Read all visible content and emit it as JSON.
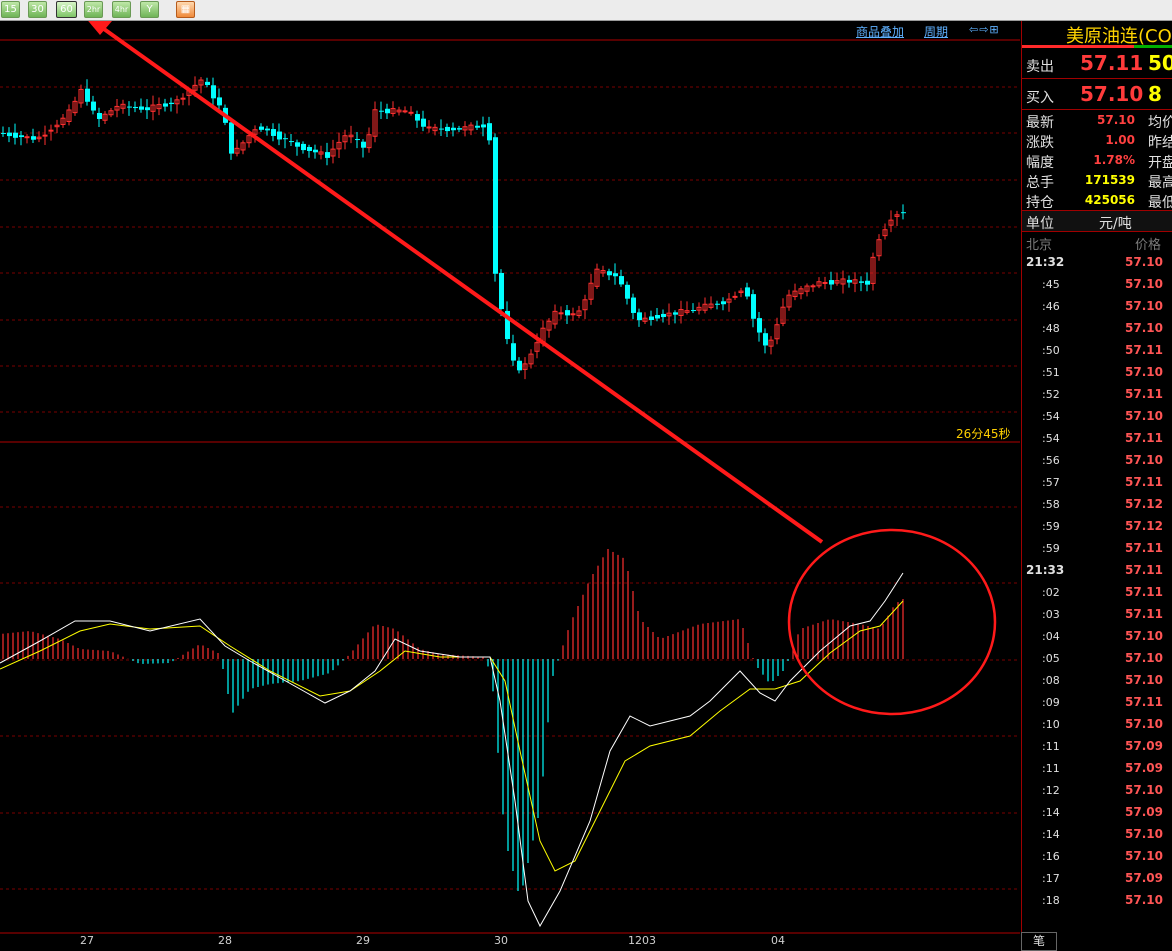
{
  "toolbar": {
    "buttons": [
      {
        "label": "15",
        "active": false
      },
      {
        "label": "30",
        "active": false
      },
      {
        "label": "60",
        "active": true
      },
      {
        "label": "2hr",
        "active": false
      },
      {
        "label": "4hr",
        "active": false
      },
      {
        "label": "Y",
        "active": false
      }
    ],
    "draw_icon": "grid-icon"
  },
  "chart_header": {
    "overlay_link": "商品叠加",
    "period_link": "周期",
    "nav_arrows": "⇦⇨⊞"
  },
  "countdown": "26分45秒",
  "x_axis_labels": [
    "27",
    "28",
    "29",
    "30",
    "1203",
    "04"
  ],
  "colors": {
    "up": "#ff3030",
    "down": "#00ffff",
    "dif_line": "#ffffff",
    "dea_line": "#ffff00",
    "grid": "#7a0000",
    "annotation": "#ff1a1a"
  },
  "chart_data": {
    "type": "candlestick",
    "series": [
      {
        "name": "price",
        "kind": "candlestick"
      },
      {
        "name": "MACD",
        "kind": "histogram"
      },
      {
        "name": "DIF",
        "kind": "line"
      },
      {
        "name": "DEA",
        "kind": "line"
      }
    ],
    "annotations": [
      "arrow from lower-right to 60 button",
      "ellipse around recent MACD golden cross"
    ]
  },
  "panel": {
    "title": "美原油连(CO",
    "sell": {
      "label": "卖出",
      "price": "57.11",
      "volume": "50"
    },
    "buy": {
      "label": "买入",
      "price": "57.10",
      "volume": "8"
    },
    "stats": [
      {
        "label": "最新",
        "value": "57.10",
        "color": "#ff4040",
        "label2": "均价"
      },
      {
        "label": "涨跌",
        "value": "1.00",
        "color": "#ff4040",
        "label2": "昨结"
      },
      {
        "label": "幅度",
        "value": "1.78%",
        "color": "#ff4040",
        "label2": "开盘"
      },
      {
        "label": "总手",
        "value": "171539",
        "color": "#ffff00",
        "label2": "最高"
      },
      {
        "label": "持仓",
        "value": "425056",
        "color": "#ffff00",
        "label2": "最低"
      }
    ],
    "unit_label": "单位",
    "unit_value": "元/吨",
    "tick_head_left": "北京",
    "tick_head_right": "价格",
    "ticks": [
      {
        "time": "21:32",
        "price": "57.10"
      },
      {
        "time": ":45",
        "price": "57.10"
      },
      {
        "time": ":46",
        "price": "57.10"
      },
      {
        "time": ":48",
        "price": "57.10"
      },
      {
        "time": ":50",
        "price": "57.11"
      },
      {
        "time": ":51",
        "price": "57.10"
      },
      {
        "time": ":52",
        "price": "57.11"
      },
      {
        "time": ":54",
        "price": "57.10"
      },
      {
        "time": ":54",
        "price": "57.11"
      },
      {
        "time": ":56",
        "price": "57.10"
      },
      {
        "time": ":57",
        "price": "57.11"
      },
      {
        "time": ":58",
        "price": "57.12"
      },
      {
        "time": ":59",
        "price": "57.12"
      },
      {
        "time": ":59",
        "price": "57.11"
      },
      {
        "time": "21:33",
        "price": "57.11"
      },
      {
        "time": ":02",
        "price": "57.11"
      },
      {
        "time": ":03",
        "price": "57.11"
      },
      {
        "time": ":04",
        "price": "57.10"
      },
      {
        "time": ":05",
        "price": "57.10"
      },
      {
        "time": ":08",
        "price": "57.10"
      },
      {
        "time": ":09",
        "price": "57.11"
      },
      {
        "time": ":10",
        "price": "57.10"
      },
      {
        "time": ":11",
        "price": "57.09"
      },
      {
        "time": ":11",
        "price": "57.09"
      },
      {
        "time": ":12",
        "price": "57.10"
      },
      {
        "time": ":14",
        "price": "57.09"
      },
      {
        "time": ":14",
        "price": "57.10"
      },
      {
        "time": ":16",
        "price": "57.10"
      },
      {
        "time": ":17",
        "price": "57.09"
      },
      {
        "time": ":18",
        "price": "57.10"
      }
    ],
    "bottom_tab": "笔"
  }
}
